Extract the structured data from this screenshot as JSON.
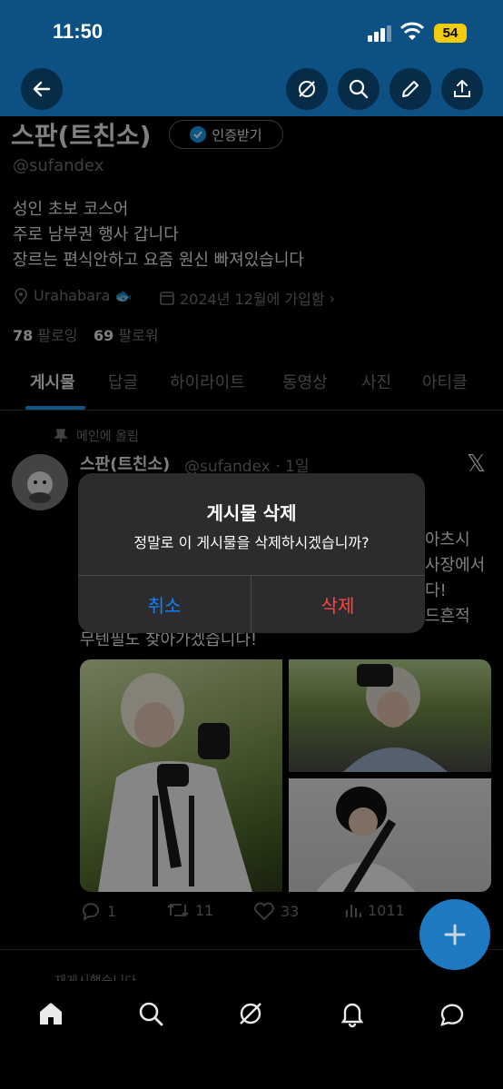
{
  "status_bar": {
    "time": "11:50",
    "battery": "54"
  },
  "nav_icons": [
    "back-arrow-icon",
    "grok-icon",
    "search-icon",
    "edit-pencil-icon",
    "share-icon"
  ],
  "profile": {
    "name": "스판(트친소)",
    "verify_label": "인증받기",
    "handle": "@sufandex",
    "bio": [
      "성인 초보 코스어",
      "주로 남부권 행사 갑니다",
      "장르는 편식안하고 요즘 원신 빠져있습니다"
    ],
    "location": "Urahabara",
    "joined": "2024년 12월에 가입함",
    "following_count": "78",
    "following_label": "팔로잉",
    "followers_count": "69",
    "followers_label": "팔로워"
  },
  "tabs": [
    "게시물",
    "답글",
    "하이라이트",
    "동영상",
    "사진",
    "아티클"
  ],
  "post": {
    "pinned_label": "메인에 올림",
    "author_name": "스판(트친소)",
    "author_meta": "@sufandex · 1일",
    "text_fragments": [
      "아츠시",
      "사장에서",
      "다!",
      "드흔적"
    ],
    "text_last_line": "무텐필도 찾아가겠습니다!",
    "replies": "1",
    "reposts": "11",
    "likes": "33",
    "views": "1011"
  },
  "next_post_partial": "재게시했습니다",
  "dialog": {
    "title": "게시물 삭제",
    "message": "정말로 이 게시물을 삭제하시겠습니까?",
    "cancel_label": "취소",
    "delete_label": "삭제"
  },
  "colors": {
    "accent": "#1d9bf0",
    "destructive": "#ff453a",
    "cancel": "#0a84ff",
    "header": "#0d5084"
  }
}
